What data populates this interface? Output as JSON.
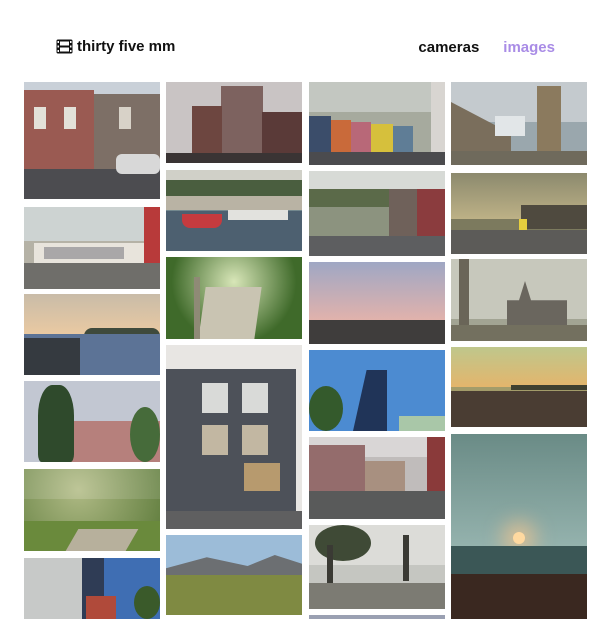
{
  "header": {
    "brand": {
      "icon": "film-icon",
      "label": "thirty five mm"
    },
    "nav": [
      {
        "label": "cameras",
        "active": false
      },
      {
        "label": "images",
        "active": true
      }
    ]
  },
  "colors": {
    "accent": "#a98ce6",
    "text": "#111111",
    "background": "#ffffff"
  },
  "gallery": {
    "photos": [
      {
        "name": "photo-victorian-houses"
      },
      {
        "name": "photo-tall-building"
      },
      {
        "name": "photo-colorful-row-houses"
      },
      {
        "name": "photo-church-tower"
      },
      {
        "name": "photo-harbour-boats"
      },
      {
        "name": "photo-street-hill"
      },
      {
        "name": "photo-parking-sunset"
      },
      {
        "name": "photo-graffiti-wall"
      },
      {
        "name": "photo-forest-stairs"
      },
      {
        "name": "photo-pink-sky-rocks"
      },
      {
        "name": "photo-foggy-church"
      },
      {
        "name": "photo-shoreline-dusk"
      },
      {
        "name": "photo-brick-storefront"
      },
      {
        "name": "photo-curved-glass-building"
      },
      {
        "name": "photo-sunset-beach"
      },
      {
        "name": "photo-tree-brick-building"
      },
      {
        "name": "photo-row-street-cars"
      },
      {
        "name": "photo-park-path"
      },
      {
        "name": "photo-hills-field"
      },
      {
        "name": "photo-harbour-lamp"
      },
      {
        "name": "photo-sunset-water"
      },
      {
        "name": "photo-apartment-tower"
      },
      {
        "name": "photo-bottom-partial"
      }
    ]
  }
}
